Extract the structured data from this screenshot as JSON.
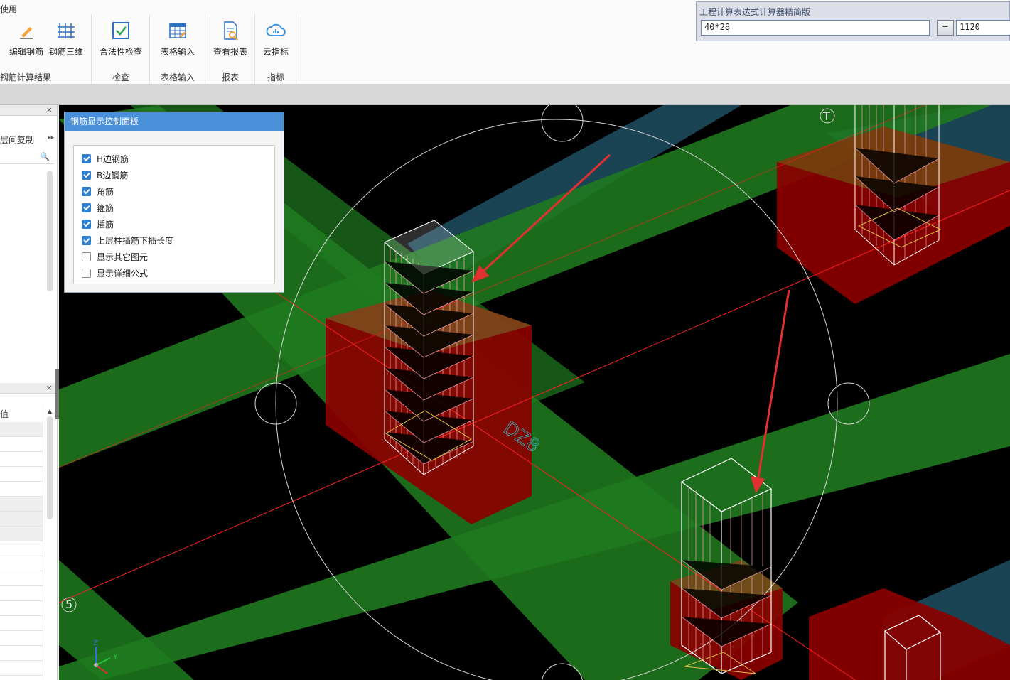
{
  "menu": {
    "partial_tab": "使用"
  },
  "ribbon": {
    "groups": [
      {
        "label": "钢筋计算结果",
        "buttons": [
          {
            "label": "编辑钢筋",
            "icon": "edit-rebar-icon"
          },
          {
            "label": "钢筋三维",
            "icon": "rebar-3d-icon"
          }
        ]
      },
      {
        "label": "检查",
        "buttons": [
          {
            "label": "合法性检查",
            "icon": "validity-check-icon"
          }
        ]
      },
      {
        "label": "表格输入",
        "buttons": [
          {
            "label": "表格输入",
            "icon": "table-input-icon"
          }
        ]
      },
      {
        "label": "报表",
        "buttons": [
          {
            "label": "查看报表",
            "icon": "view-report-icon"
          }
        ]
      },
      {
        "label": "指标",
        "buttons": [
          {
            "label": "云指标",
            "icon": "cloud-index-icon"
          }
        ]
      }
    ]
  },
  "calculator": {
    "title": "工程计算表达式计算器精简版",
    "expression": "40*28",
    "equals_label": "=",
    "result": "1120"
  },
  "left_panel": {
    "copy_label": "层间复制",
    "arrow": "▸▸",
    "close": "×",
    "grid_header": "值"
  },
  "rebar_panel": {
    "title": "钢筋显示控制面板",
    "options": [
      {
        "label": "H边钢筋",
        "checked": true
      },
      {
        "label": "B边钢筋",
        "checked": true
      },
      {
        "label": "角筋",
        "checked": true
      },
      {
        "label": "箍筋",
        "checked": true
      },
      {
        "label": "插筋",
        "checked": true
      },
      {
        "label": "上层柱插筋下插长度",
        "checked": true
      },
      {
        "label": "显示其它图元",
        "checked": false
      },
      {
        "label": "显示详细公式",
        "checked": false
      }
    ]
  },
  "viewport": {
    "axis_top": "T",
    "axis_left": "5",
    "element_label": "DZ8",
    "axis_x": "Y",
    "axis_z": "Z"
  },
  "colors": {
    "beam": "#1f7a1f",
    "cap": "#8b0000",
    "slab": "#1d4a5c",
    "rebar": "#ffffff",
    "arrow": "#e03030"
  }
}
